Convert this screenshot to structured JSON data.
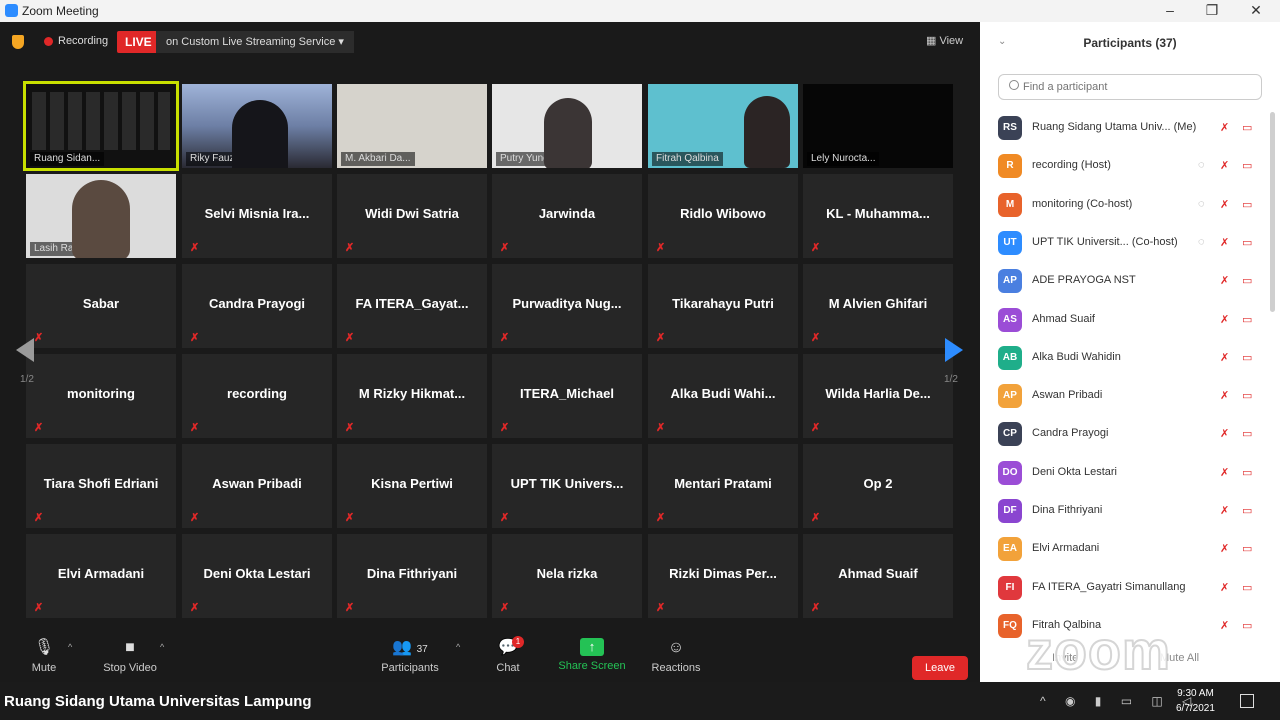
{
  "window": {
    "title": "Zoom Meeting"
  },
  "topbar": {
    "recording_label": "Recording",
    "live_label": "LIVE",
    "live_service": "on Custom Live Streaming Service ▾",
    "view_label": "View"
  },
  "pagination": {
    "left": "1/2",
    "right": "1/2"
  },
  "video_tiles": [
    {
      "caption": "Ruang Sidan..."
    },
    {
      "caption": "Riky Fauzi"
    },
    {
      "caption": "M. Akbari Da..."
    },
    {
      "caption": "Putry Yunesti"
    },
    {
      "caption": "Fitrah Qalbina"
    },
    {
      "caption": "Lely Nurocta..."
    },
    {
      "caption": "Lasih Rahm..."
    }
  ],
  "name_tiles": [
    "Selvi Misnia Ira...",
    "Widi Dwi Satria",
    "Jarwinda",
    "Ridlo Wibowo",
    "KL - Muhamma...",
    "Sabar",
    "Candra Prayogi",
    "FA ITERA_Gayat...",
    "Purwaditya Nug...",
    "Tikarahayu Putri",
    "M Alvien Ghifari",
    "monitoring",
    "recording",
    "M Rizky Hikmat...",
    "ITERA_Michael",
    "Alka Budi Wahi...",
    "Wilda Harlia De...",
    "Tiara Shofi Edriani",
    "Aswan Pribadi",
    "Kisna Pertiwi",
    "UPT TIK Univers...",
    "Mentari Pratami",
    "Op 2",
    "Elvi Armadani",
    "Deni Okta Lestari",
    "Dina Fithriyani",
    "Nela rizka",
    "Rizki Dimas Per...",
    "Ahmad Suaif"
  ],
  "toolbar": {
    "mute": "Mute",
    "stop_video": "Stop Video",
    "participants": "Participants",
    "participants_count": "37",
    "chat": "Chat",
    "chat_badge": "1",
    "share_screen": "Share Screen",
    "reactions": "Reactions",
    "leave": "Leave"
  },
  "panel": {
    "title": "Participants (37)",
    "search_placeholder": "Find a participant",
    "participants": [
      {
        "initials": "RS",
        "name": "Ruang Sidang Utama Univ... (Me)",
        "color": "#3b4256"
      },
      {
        "initials": "R",
        "name": "recording (Host)",
        "color": "#f08a24"
      },
      {
        "initials": "M",
        "name": "monitoring (Co-host)",
        "color": "#e8632b"
      },
      {
        "initials": "UT",
        "name": "UPT TIK Universit... (Co-host)",
        "color": "#2d8cff"
      },
      {
        "initials": "AP",
        "name": "ADE PRAYOGA NST",
        "color": "#4a7fe0"
      },
      {
        "initials": "AS",
        "name": "Ahmad Suaif",
        "color": "#9b4dd6"
      },
      {
        "initials": "AB",
        "name": "Alka Budi Wahidin",
        "color": "#1fae8a"
      },
      {
        "initials": "AP",
        "name": "Aswan Pribadi",
        "color": "#f2a23a"
      },
      {
        "initials": "CP",
        "name": "Candra Prayogi",
        "color": "#3b4256"
      },
      {
        "initials": "DO",
        "name": "Deni Okta Lestari",
        "color": "#9b4dd6"
      },
      {
        "initials": "DF",
        "name": "Dina Fithriyani",
        "color": "#8a45d0"
      },
      {
        "initials": "EA",
        "name": "Elvi Armadani",
        "color": "#f2a23a"
      },
      {
        "initials": "FI",
        "name": "FA ITERA_Gayatri Simanullang",
        "color": "#e0383d"
      },
      {
        "initials": "FQ",
        "name": "Fitrah Qalbina",
        "color": "#e8632b"
      }
    ],
    "invite": "Invite",
    "mute_all": "Mute All"
  },
  "watermark": "zoom",
  "taskbar": {
    "title": "Ruang Sidang Utama Universitas Lampung",
    "time": "9:30 AM",
    "date": "6/7/2021"
  }
}
